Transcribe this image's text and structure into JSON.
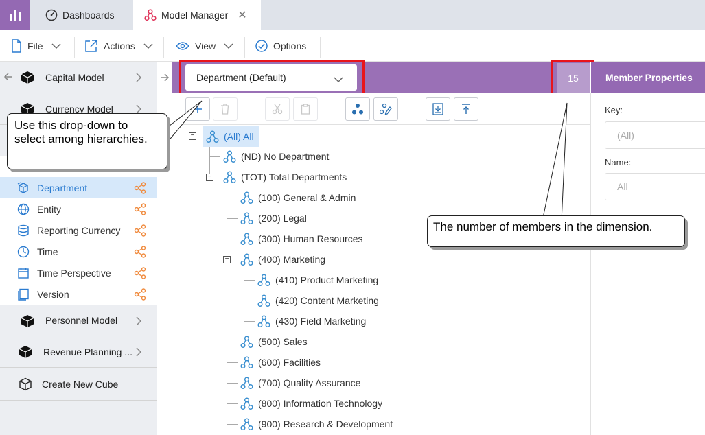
{
  "tabs": {
    "dashboards": "Dashboards",
    "model_manager": "Model Manager"
  },
  "toolbar": {
    "file": "File",
    "actions": "Actions",
    "view": "View",
    "options": "Options"
  },
  "sidebar": {
    "cubes_top": [
      {
        "label": "Capital Model"
      },
      {
        "label": "Currency Model"
      }
    ],
    "dimensions": [
      {
        "label": "Department",
        "icon": "cube-open-icon"
      },
      {
        "label": "Entity",
        "icon": "globe-icon"
      },
      {
        "label": "Reporting Currency",
        "icon": "coins-icon"
      },
      {
        "label": "Time",
        "icon": "clock-icon"
      },
      {
        "label": "Time Perspective",
        "icon": "calendar-icon"
      },
      {
        "label": "Version",
        "icon": "pages-icon"
      }
    ],
    "cubes_bottom": [
      {
        "label": "Personnel Model"
      },
      {
        "label": "Revenue Planning ..."
      }
    ],
    "create_cube": "Create New Cube"
  },
  "hierarchy": {
    "selected": "Department (Default)",
    "member_count": "15"
  },
  "properties": {
    "title": "Member Properties",
    "key_label": "Key:",
    "key_value": "(All)",
    "name_label": "Name:",
    "name_value": "All"
  },
  "tree": {
    "root": "(All) All",
    "nodes": [
      "(ND) No Department",
      "(TOT) Total Departments",
      "(100) General & Admin",
      "(200) Legal",
      "(300) Human Resources",
      "(400) Marketing",
      "(410) Product Marketing",
      "(420) Content Marketing",
      "(430) Field Marketing",
      "(500) Sales",
      "(600) Facilities",
      "(700) Quality Assurance",
      "(800) Information Technology",
      "(900) Research & Development"
    ]
  },
  "callouts": {
    "dropdown": "Use this drop-down to select among hierarchies.",
    "count": "The number of members in the dimension."
  },
  "colors": {
    "accent_purple": "#9469b3",
    "highlight_red": "#e8141b",
    "share_orange": "#f08a3c",
    "node_blue": "#3a8fd0"
  }
}
